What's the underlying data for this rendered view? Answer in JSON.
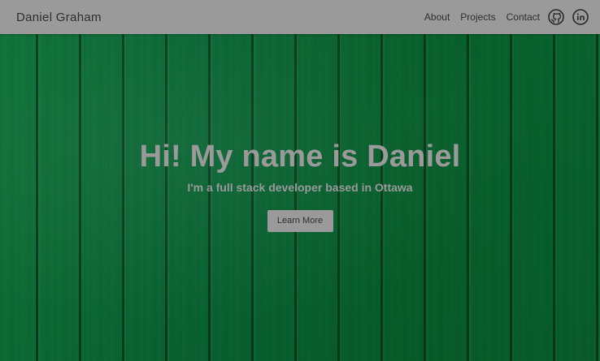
{
  "navbar": {
    "brand": "Daniel Graham",
    "links": [
      {
        "label": "About"
      },
      {
        "label": "Projects"
      },
      {
        "label": "Contact"
      }
    ],
    "icons": [
      "github-icon",
      "linkedin-icon"
    ]
  },
  "hero": {
    "title": "Hi! My name is Daniel",
    "subtitle": "I'm a full stack developer based in Ottawa",
    "cta_label": "Learn More"
  },
  "colors": {
    "navbar_bg": "#9a9a9a",
    "hero_bg": "#096a33",
    "hero_text": "#9a9a9a",
    "button_bg": "#9a9a9a"
  }
}
